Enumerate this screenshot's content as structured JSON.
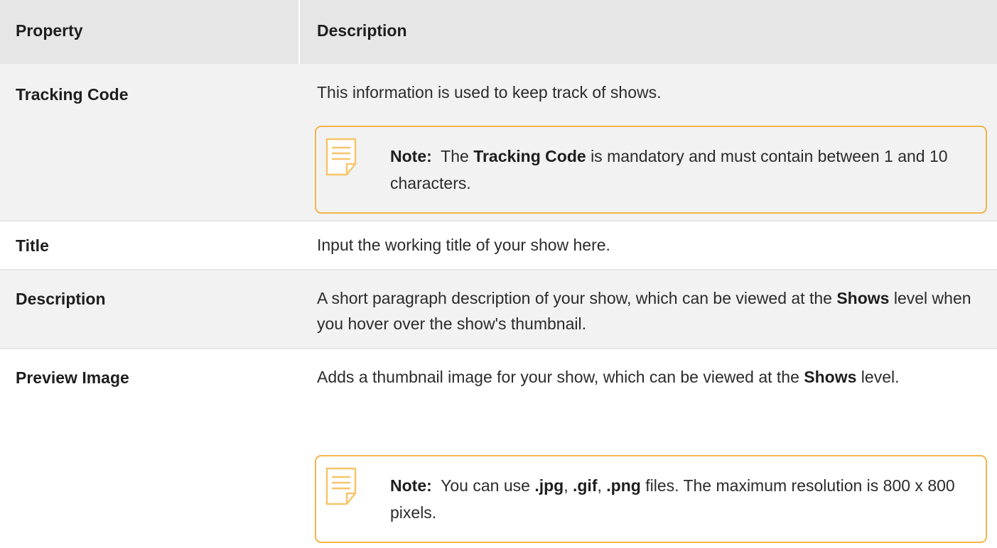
{
  "header": {
    "property": "Property",
    "description": "Description"
  },
  "rows": [
    {
      "property": "Tracking Code",
      "description": "This information is used to keep track of shows.",
      "note": {
        "label": "Note:",
        "pre": "The",
        "bold": "Tracking Code",
        "post": "is mandatory and must contain between 1 and 10 characters."
      }
    },
    {
      "property": "Title",
      "description": "Input the working title of your show here."
    },
    {
      "property": "Description",
      "description_pre": "A short paragraph description of your show, which can be viewed at the",
      "description_bold": "Shows",
      "description_post": "level when you hover over the show's thumbnail."
    },
    {
      "property": "Preview Image",
      "description_pre": "Adds a thumbnail image for your show, which can be viewed at the",
      "description_bold": "Shows",
      "description_post": "level.",
      "note": {
        "label": "Note:",
        "pre": "You can use",
        "ext1": ".jpg",
        "sep1": ",",
        "ext2": ".gif",
        "sep2": ",",
        "ext3": ".png",
        "post": "files. The maximum resolution is 800 x 800 pixels."
      }
    }
  ],
  "colors": {
    "header_bg": "#e6e6e6",
    "row_alt_bg": "#f2f2f2",
    "note_border": "#f3b54a"
  },
  "icons": {
    "note": "note-page-icon"
  }
}
